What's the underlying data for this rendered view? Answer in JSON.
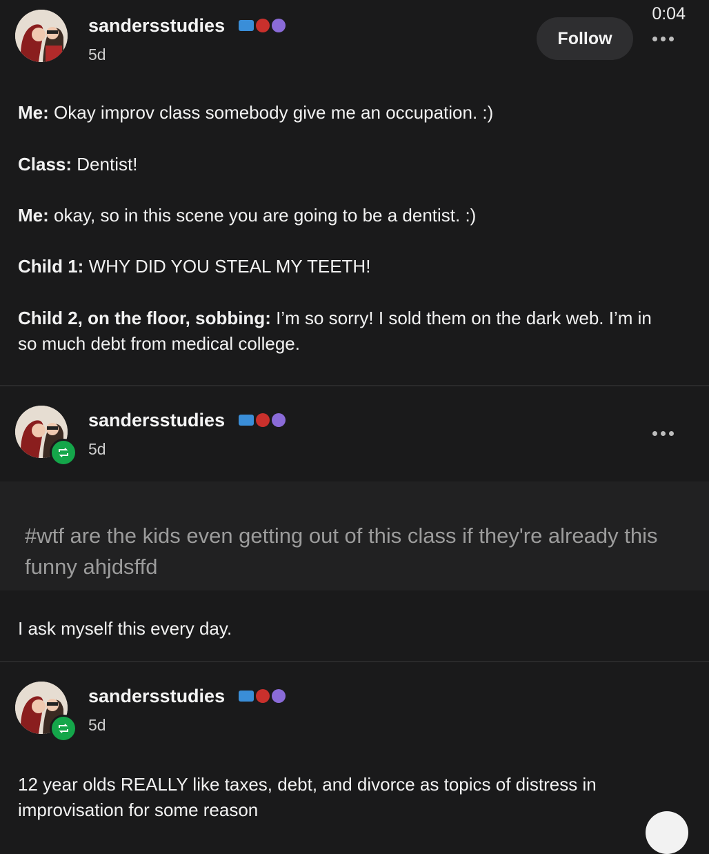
{
  "video": {
    "timer": "0:04"
  },
  "posts": [
    {
      "username": "sandersstudies",
      "time": "5d",
      "follow_label": "Follow",
      "lines": [
        {
          "speaker": "Me:",
          "text": " Okay improv class somebody give me an occupation. :)"
        },
        {
          "speaker": "Class:",
          "text": " Dentist!"
        },
        {
          "speaker": "Me:",
          "text": " okay, so in this scene you are going to be a dentist. :)"
        },
        {
          "speaker": "Child 1:",
          "text": " WHY DID YOU STEAL MY TEETH!"
        },
        {
          "speaker": "Child 2, on the floor, sobbing:",
          "text": " I’m so sorry! I sold them on the dark web. I’m in so much debt from medical college."
        }
      ]
    },
    {
      "username": "sandersstudies",
      "time": "5d",
      "tag_text": "#wtf are the kids even getting out of this class if they're already this funny ahjdsffd",
      "reply": "I ask myself this every day."
    },
    {
      "username": "sandersstudies",
      "time": "5d",
      "text": "12 year olds REALLY like taxes, debt, and divorce as topics of distress in improvisation for some reason"
    }
  ],
  "icons": {
    "avatar": "avatar-image",
    "reblog": "reblog-icon",
    "more": "more-options-icon",
    "badges": [
      "blue-scroll-badge",
      "red-hexagon-badge",
      "purple-paw-badge"
    ]
  },
  "colors": {
    "background": "#1a1a1b",
    "reblog_badge": "#14a64a",
    "follow_button": "#2e2e30",
    "tag_text": "#9c9c9c"
  }
}
